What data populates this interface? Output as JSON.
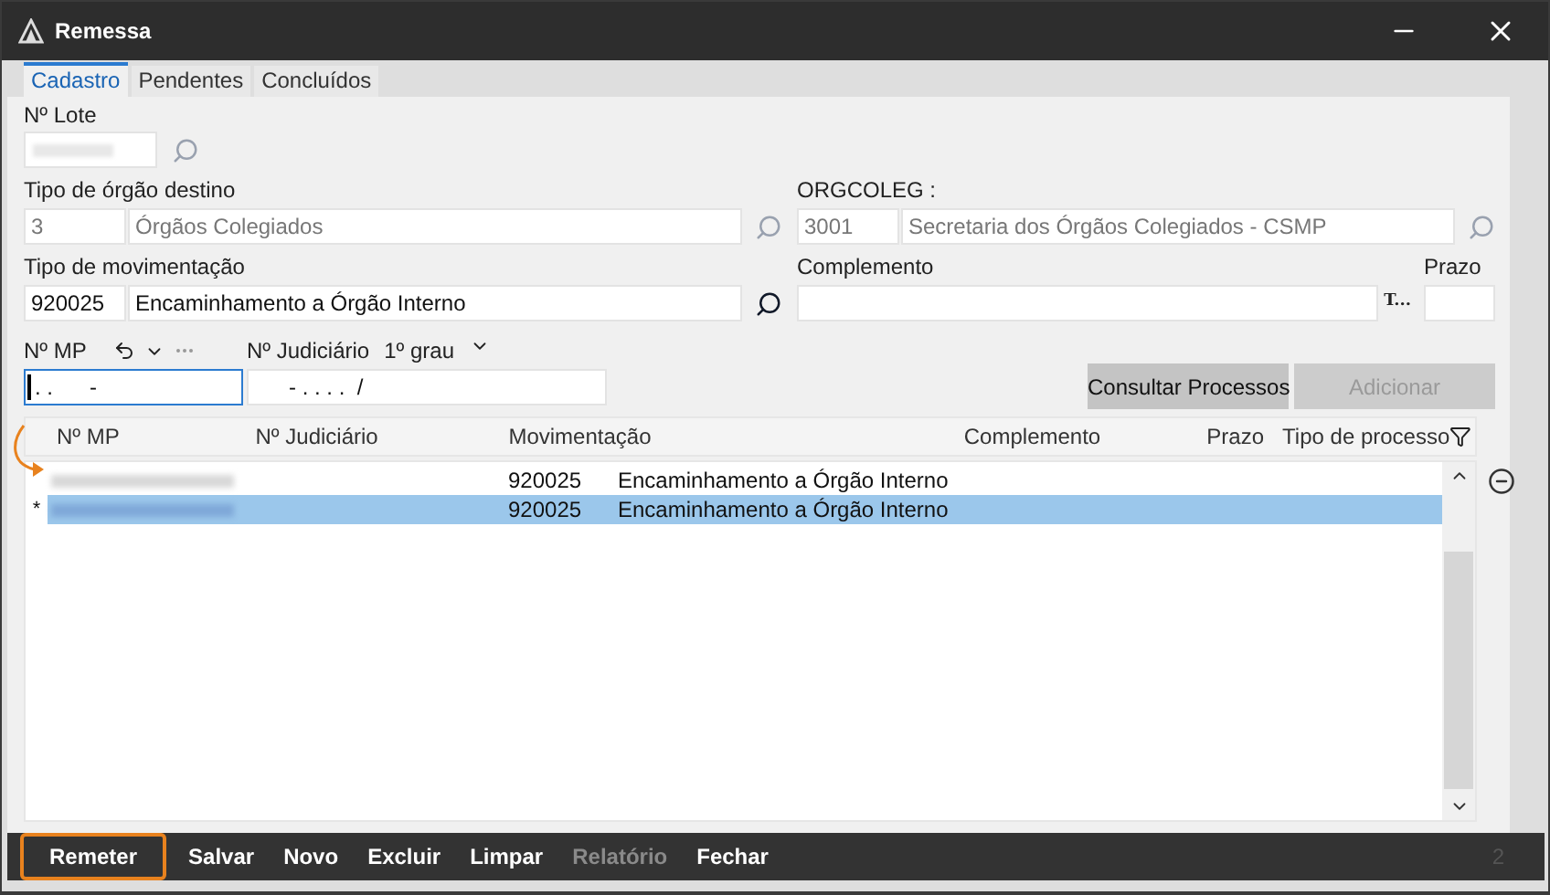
{
  "window": {
    "title": "Remessa"
  },
  "tabs": [
    {
      "label": "Cadastro",
      "selected": true
    },
    {
      "label": "Pendentes",
      "selected": false
    },
    {
      "label": "Concluídos",
      "selected": false
    }
  ],
  "lote": {
    "label": "Nº Lote"
  },
  "orgao_destino": {
    "label": "Tipo de órgão destino",
    "code": "3",
    "name": "Órgãos Colegiados",
    "disabled": true
  },
  "orgcoleg": {
    "label": "ORGCOLEG :",
    "code": "3001",
    "name": "Secretaria dos Órgãos Colegiados - CSMP",
    "disabled": true
  },
  "movimentacao": {
    "label": "Tipo de movimentação",
    "code": "920025",
    "name": "Encaminhamento a Órgão Interno",
    "disabled": false
  },
  "complemento": {
    "label": "Complemento",
    "button": "T..."
  },
  "prazo": {
    "label": "Prazo"
  },
  "mp": {
    "label": "Nº MP",
    "value": ". .      -"
  },
  "judiciario": {
    "label": "Nº Judiciário",
    "grau": "1º grau",
    "value": "- . . . .  /"
  },
  "actions": [
    {
      "label": "Consultar Processos",
      "disabled": false
    },
    {
      "label": "Adicionar",
      "disabled": true
    }
  ],
  "grid": {
    "columns": [
      "Nº MP",
      "Nº Judiciário",
      "Movimentação",
      "Complemento",
      "Prazo",
      "Tipo de processo"
    ],
    "rows": [
      {
        "marker": "",
        "code": "920025",
        "movimentacao": "Encaminhamento a Órgão Interno",
        "selected": false
      },
      {
        "marker": "*",
        "code": "920025",
        "movimentacao": "Encaminhamento a Órgão Interno",
        "selected": true
      }
    ]
  },
  "footer": {
    "buttons": [
      {
        "label": "Remeter",
        "disabled": false,
        "highlighted": true
      },
      {
        "label": "Salvar",
        "disabled": false,
        "highlighted": false
      },
      {
        "label": "Novo",
        "disabled": false,
        "highlighted": false
      },
      {
        "label": "Excluir",
        "disabled": false,
        "highlighted": false
      },
      {
        "label": "Limpar",
        "disabled": false,
        "highlighted": false
      },
      {
        "label": "Relatório",
        "disabled": true,
        "highlighted": false
      },
      {
        "label": "Fechar",
        "disabled": false,
        "highlighted": false
      }
    ],
    "page": "2"
  }
}
